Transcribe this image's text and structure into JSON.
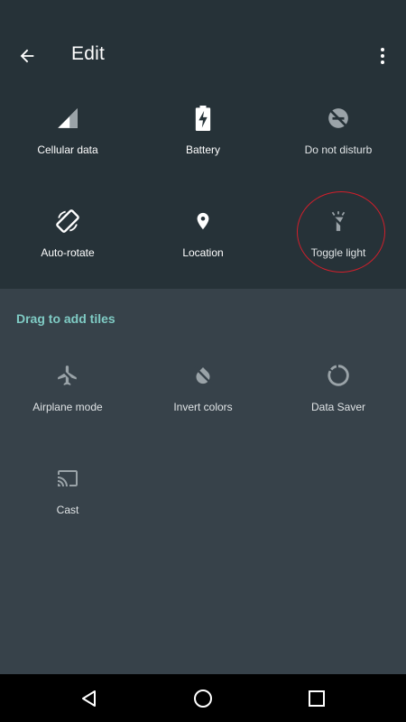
{
  "toolbar": {
    "title": "Edit",
    "back_icon": "arrow-back-icon",
    "menu_icon": "more-vert-icon"
  },
  "active_tiles": [
    {
      "label": "Cellular data",
      "icon": "cellular-signal-icon"
    },
    {
      "label": "Battery",
      "icon": "battery-charging-icon"
    },
    {
      "label": "Do not disturb",
      "icon": "do-not-disturb-off-icon"
    },
    {
      "label": "Auto-rotate",
      "icon": "screen-rotation-icon"
    },
    {
      "label": "Location",
      "icon": "location-pin-icon"
    },
    {
      "label": "Toggle light",
      "icon": "flashlight-off-icon"
    }
  ],
  "drag_section": {
    "title": "Drag to add tiles"
  },
  "available_tiles": [
    {
      "label": "Airplane mode",
      "icon": "airplane-off-icon"
    },
    {
      "label": "Invert colors",
      "icon": "invert-colors-off-icon"
    },
    {
      "label": "Data Saver",
      "icon": "data-saver-icon"
    },
    {
      "label": "Cast",
      "icon": "cast-icon"
    }
  ],
  "nav": {
    "back_icon": "nav-back-icon",
    "home_icon": "nav-home-icon",
    "recents_icon": "nav-recents-icon"
  },
  "colors": {
    "header_bg": "#263238",
    "lower_bg": "#37424a",
    "accent": "#7fcbc4",
    "highlight": "#d21f2b"
  }
}
